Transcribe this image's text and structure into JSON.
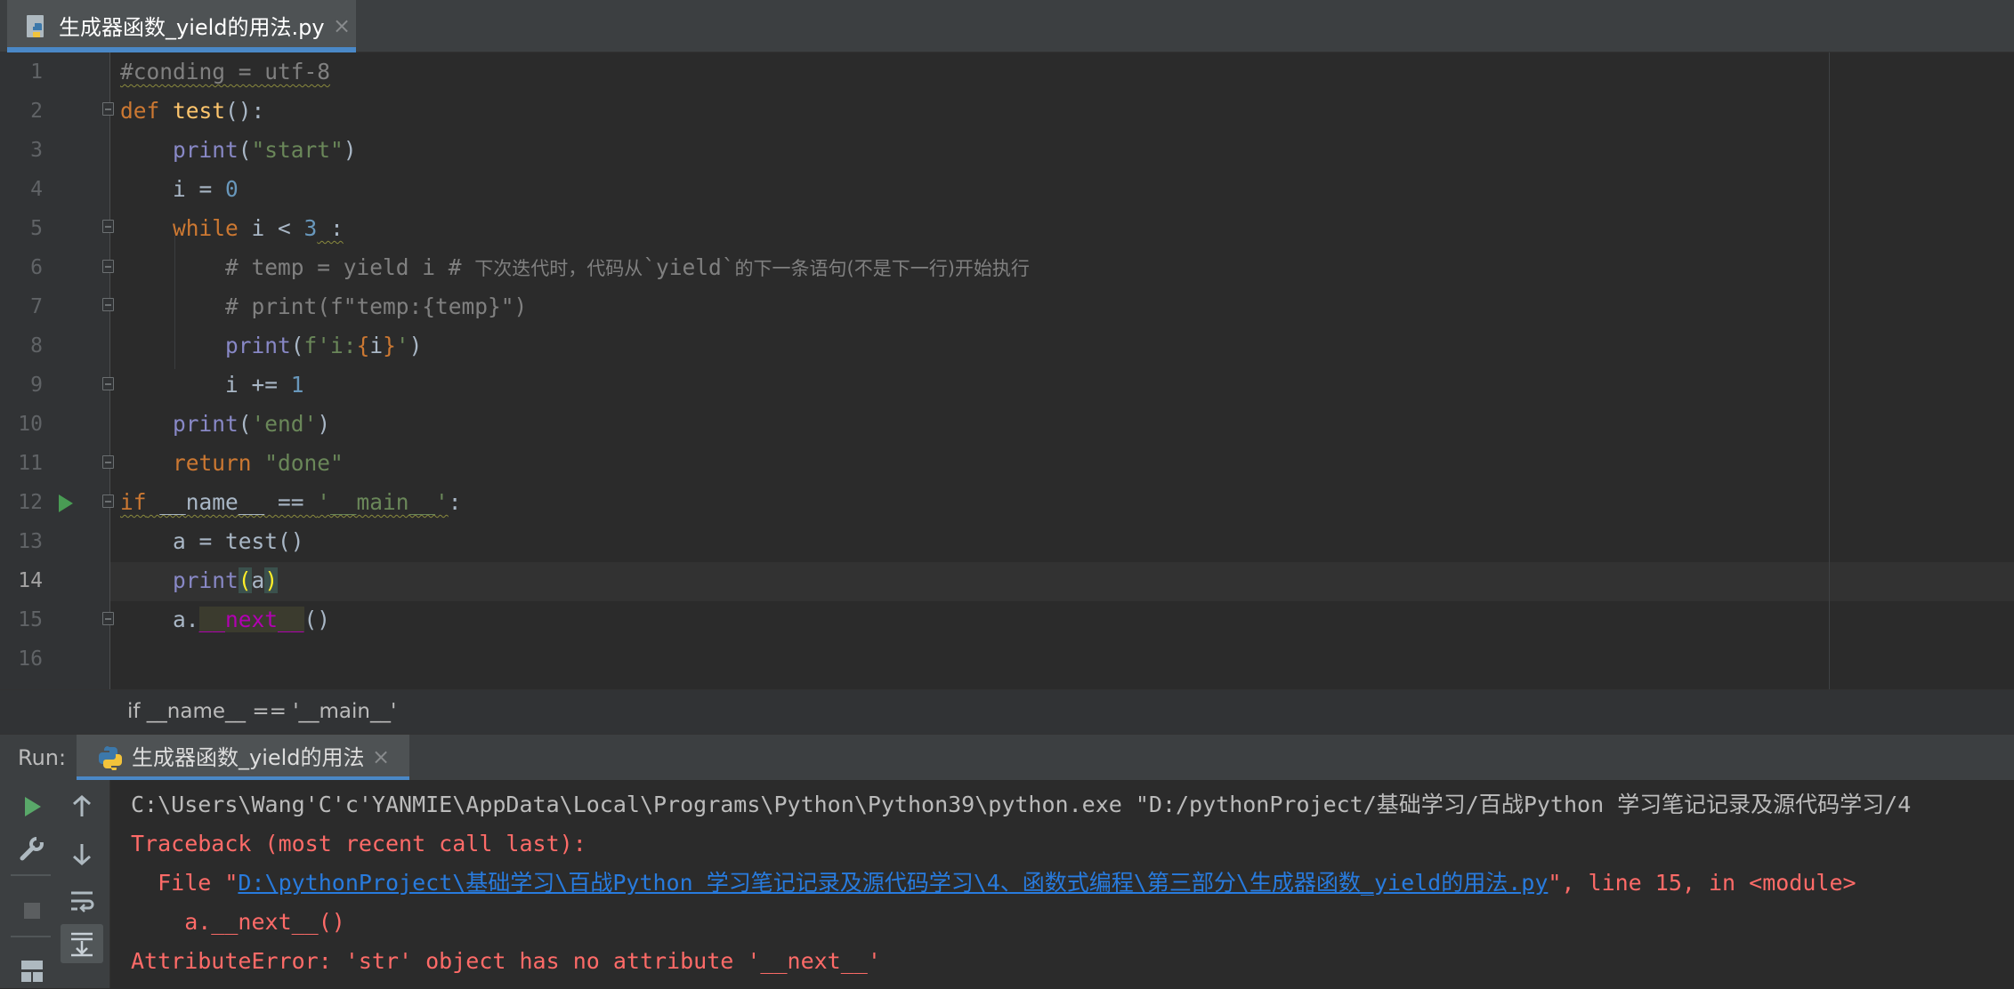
{
  "editor_tab": {
    "icon": "python-file-icon",
    "label": "生成器函数_yield的用法.py",
    "close": "×"
  },
  "gutter": {
    "line_numbers": [
      "1",
      "2",
      "3",
      "4",
      "5",
      "6",
      "7",
      "8",
      "9",
      "10",
      "11",
      "12",
      "13",
      "14",
      "15",
      "16"
    ],
    "current_line": "14"
  },
  "code": {
    "l1": "#conding = utf-8",
    "l2": {
      "kw": "def",
      "name": "test",
      "rest": "():"
    },
    "l3": {
      "fn": "print",
      "open": "(",
      "str": "\"start\"",
      "close": ")"
    },
    "l4": {
      "lhs": "i = ",
      "num": "0"
    },
    "l5": {
      "kw": "while",
      "mid": " i < ",
      "num": "3",
      "end": " :"
    },
    "l6": {
      "code": "# temp = yield i # ",
      "cn1": "下次迭代时，代码从",
      "code2": "`yield`",
      "cn2": "的下一条语句(不是下一行)开始执行"
    },
    "l7": "# print(f\"temp:{temp}\")",
    "l8": {
      "fn": "print",
      "open": "(",
      "s1": "f'i:",
      "b1": "{",
      "v": "i",
      "b2": "}",
      "s2": "'",
      "close": ")"
    },
    "l9": {
      "lhs": "i += ",
      "num": "1"
    },
    "l10": {
      "fn": "print",
      "open": "(",
      "str": "'end'",
      "close": ")"
    },
    "l11": {
      "kw": "return",
      "str": " \"done\""
    },
    "l12": {
      "kw": "if",
      "mid": " __name__ == ",
      "str": "'__main__'",
      "end": ":"
    },
    "l13": "a = test()",
    "l14": {
      "fn": "print",
      "open": "(",
      "arg": "a",
      "close": ")"
    },
    "l15": {
      "pre": "a.",
      "mg": "__next__",
      "post": "()"
    }
  },
  "breadcrumb": "if __name__ == '__main__'",
  "run_panel": {
    "label": "Run:",
    "tab_icon": "python-icon",
    "tab_label": "生成器函数_yield的用法",
    "tab_close": "×"
  },
  "toolbar_icons": [
    "rerun-icon",
    "wrench-icon",
    "stop-icon",
    "layout-icon",
    "up-arrow-icon",
    "down-arrow-icon",
    "soft-wrap-icon",
    "scroll-to-end-icon"
  ],
  "console": {
    "cmd": "C:\\Users\\Wang'C'c'YANMIE\\AppData\\Local\\Programs\\Python\\Python39\\python.exe \"D:/pythonProject/基础学习/百战Python 学习笔记记录及源代码学习/4",
    "tb_header": "Traceback (most recent call last):",
    "file_prefix": "  File \"",
    "file_link": "D:\\pythonProject\\基础学习\\百战Python 学习笔记记录及源代码学习\\4、函数式编程\\第三部分\\生成器函数_yield的用法.py",
    "file_suffix": "\", line 15, in <module>",
    "tb_code": "    a.__next__()",
    "error": "AttributeError: 'str' object has no attribute '__next__'"
  },
  "colors": {
    "background": "#2b2b2b",
    "keyword": "#cc7832",
    "string": "#6a8759",
    "number": "#6897bb",
    "function": "#ffc66d",
    "builtin": "#8888c6",
    "error": "#ff6b68",
    "link": "#287bde",
    "accent": "#4a88c7"
  }
}
